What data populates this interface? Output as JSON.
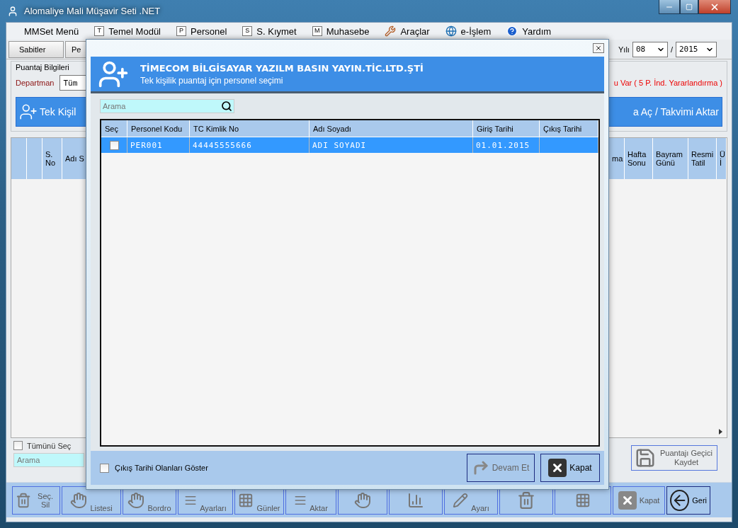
{
  "window": {
    "title": "Alomaliye Mali Müşavir Seti .NET"
  },
  "menu": [
    {
      "kind": "plain",
      "label": "MMSet Menü"
    },
    {
      "kind": "letter",
      "key": "T",
      "label": "Temel Modül"
    },
    {
      "kind": "letter",
      "key": "P",
      "label": "Personel"
    },
    {
      "kind": "letter",
      "key": "S",
      "label": "S. Kıymet"
    },
    {
      "kind": "letter",
      "key": "M",
      "label": "Muhasebe"
    },
    {
      "kind": "tools",
      "label": "Araçlar"
    },
    {
      "kind": "globe",
      "label": "e-İşlem"
    },
    {
      "kind": "help",
      "label": "Yardım"
    }
  ],
  "tabs": [
    {
      "label": "Sabitler"
    },
    {
      "label": "Pe"
    }
  ],
  "period": {
    "label": "Yılı",
    "month": "08",
    "separator": "/",
    "year": "2015"
  },
  "puantaj": {
    "title": "Puantaj Bilgileri",
    "department_label": "Departman",
    "department_value": "Tüm",
    "notice": "u Var ( 5 P. İnd. Yararlandırma )",
    "single_button": "Tek Kişil",
    "calendar_button": "a Aç / Takvimi Aktar"
  },
  "grid": {
    "left_columns": [
      "S. No",
      "Adı S"
    ],
    "right_columns": [
      "ma",
      "Hafta Sonu",
      "Bayram Günü",
      "Resmi Tatil",
      "Ü\nİ"
    ]
  },
  "select_all": {
    "label": "Tümünü Seç",
    "checked": false
  },
  "search": {
    "placeholder": "Arama"
  },
  "save_temp_button": "Puantajı Geçici Kaydet",
  "bottom_buttons": [
    {
      "kind": "trash",
      "label": "Seç. Sil"
    },
    {
      "kind": "hand",
      "label": "Listesi"
    },
    {
      "kind": "hand",
      "label": "Bordro"
    },
    {
      "kind": "bars",
      "label": "Ayarları"
    },
    {
      "kind": "grid",
      "label": "Günler"
    },
    {
      "kind": "bars",
      "label": "Aktar"
    },
    {
      "kind": "hand"
    },
    {
      "kind": "chart"
    },
    {
      "kind": "pencil",
      "label": "Ayarı"
    },
    {
      "kind": "trash"
    },
    {
      "kind": "grid"
    },
    {
      "kind": "close",
      "label": "Kapat"
    },
    {
      "kind": "back",
      "label": "Geri"
    }
  ],
  "dialog": {
    "company": "TİMECOM BİLGİSAYAR YAZILM BASIN YAYIN.TİC.LTD.ŞTİ",
    "subtitle": "Tek kişilik puantaj için personel seçimi",
    "search": {
      "placeholder": "Arama"
    },
    "table": {
      "check_column": "Seç",
      "columns": [
        "Personel Kodu",
        "TC Kimlik No",
        "Adı Soyadı",
        "Giriş Tarihi",
        "Çıkış Tarihi"
      ],
      "rows": [
        {
          "selected": true,
          "checked": false,
          "cells": [
            "PER001",
            "44445555666",
            "ADI SOYADI",
            "01.01.2015"
          ]
        }
      ]
    },
    "show_exited": {
      "label": "Çıkış Tarihi Olanları Göster",
      "checked": false
    },
    "buttons": [
      {
        "kind": "continue",
        "label": "Devam Et",
        "disabled": true
      },
      {
        "kind": "close",
        "label": "Kapat",
        "disabled": false
      }
    ]
  }
}
